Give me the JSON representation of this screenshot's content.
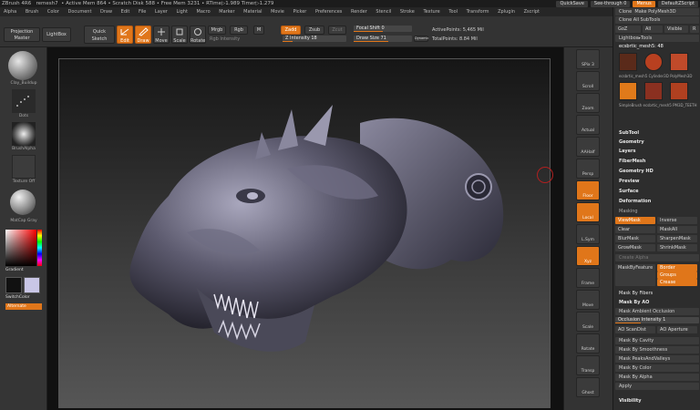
{
  "title": {
    "app": "ZBrush 4R6",
    "mesh": "remesh7",
    "active_mesh": "Active Mem 864",
    "scratch_disk": "Scratch Disk 588",
    "free_mem": "Free Mem 3231",
    "rtime": "RTime▷1.989",
    "timer": "Timer▷1.279",
    "quicksave": "QuickSave",
    "seethrough": "See-through  0",
    "menus": "Menus",
    "default_script": "DefaultZScript"
  },
  "menubar": {
    "items": [
      "Alpha",
      "Brush",
      "Color",
      "Document",
      "Draw",
      "Edit",
      "File",
      "Layer",
      "Light",
      "Macro",
      "Marker",
      "Material",
      "Movie",
      "Picker",
      "Preferences",
      "Render",
      "Stencil",
      "Stroke",
      "Texture",
      "Tool",
      "Transform",
      "Zplugin",
      "Zscript"
    ]
  },
  "toolbar": {
    "projection_master": "Projection Master",
    "lightbox": "LightBox",
    "quick_sketch": "Quick Sketch",
    "edit": "Edit",
    "draw": "Draw",
    "move": "Move",
    "scale": "Scale",
    "rotate": "Rotate",
    "mrgb": "Mrgb",
    "rgb": "Rgb",
    "m": "M",
    "rgb_intensity": "Rgb Intensity",
    "zadd": "Zadd",
    "zsub": "Zsub",
    "zcut": "Zcut",
    "z_intensity": "Z Intensity 18",
    "focal_shift": "Focal Shift 0",
    "draw_size": "Draw Size 71",
    "dynamic": "Dynamic",
    "active_points": "ActivePoints: 5,465 Mil",
    "total_points": "TotalPoints: 8.84 Mil"
  },
  "leftshelf": {
    "brush_label": "Clay_Buildup",
    "stroke_label": "Dots",
    "alpha_label": "BrushAlpha",
    "texture_label": "Texture Off",
    "material_label": "MatCap Gray",
    "gradient": "Gradient",
    "switchcolor": "SwitchColor",
    "alternate": "Alternate"
  },
  "rightshelf": {
    "items": [
      "SPix 3",
      "Scroll",
      "Zoom",
      "Actual",
      "AAHalf",
      "Persp",
      "Floor",
      "Local",
      "L.Sym",
      "Xyz",
      "Frame",
      "Move",
      "Scale",
      "Rotate",
      "Transp",
      "Ghost",
      "Solo",
      "Xpose"
    ]
  },
  "tray": {
    "top_items": [
      "Clone",
      "Make PolyMesh3D"
    ],
    "clone_all": "Clone All SubTools",
    "goz": "GoZ",
    "all": "All",
    "visible": "Visible",
    "r": "R",
    "lightbox_tools": "Lightbox▸Tools",
    "current_tool": "ecsbrtic_mesh5: 48",
    "tools": [
      "ecsbrtic_mesh5",
      "Cylinder3D",
      "PolyMesh3D",
      "SimpleBrush",
      "ecsbrtic_mesh5",
      "PM3D_TEETH"
    ],
    "sections": [
      "SubTool",
      "Geometry",
      "Layers",
      "FiberMesh",
      "Geometry HD",
      "Preview",
      "Surface",
      "Deformation",
      "Masking"
    ],
    "masking": {
      "viewmask": "ViewMask",
      "inverse": "Inverse",
      "clear": "Clear",
      "mask_all": "MaskAll",
      "blur_mask": "BlurMask",
      "sharpen_mask": "SharpenMask",
      "grow_mask": "GrowMask",
      "shrink_mask": "ShrinkMask",
      "create_alpha": "Create Alpha",
      "mask_by_feature": "MaskByFeature",
      "border": "Border",
      "groups": "Groups",
      "crease": "Crease",
      "mask_by_fibers": "Mask By Fibers",
      "mask_by_ao": "Mask By AO",
      "mask_ambient": "Mask Ambient Occlusion",
      "occlusion_intensity": "Occlusion Intensity 1",
      "ao_scandist": "AO ScanDist",
      "ao_aperture": "AO Aperture",
      "mask_by_cavity": "Mask By Cavity",
      "mask_by_smoothness": "Mask By Smoothness",
      "mask_peaks": "Mask PeaksAndValleys",
      "mask_by_color": "Mask By Color",
      "mask_by_alpha": "Mask By Alpha",
      "apply": "Apply",
      "visibility": "Visibility"
    }
  },
  "colors": {
    "accent": "#e0761a",
    "panel": "#333333",
    "canvas_bg": "#111111"
  }
}
